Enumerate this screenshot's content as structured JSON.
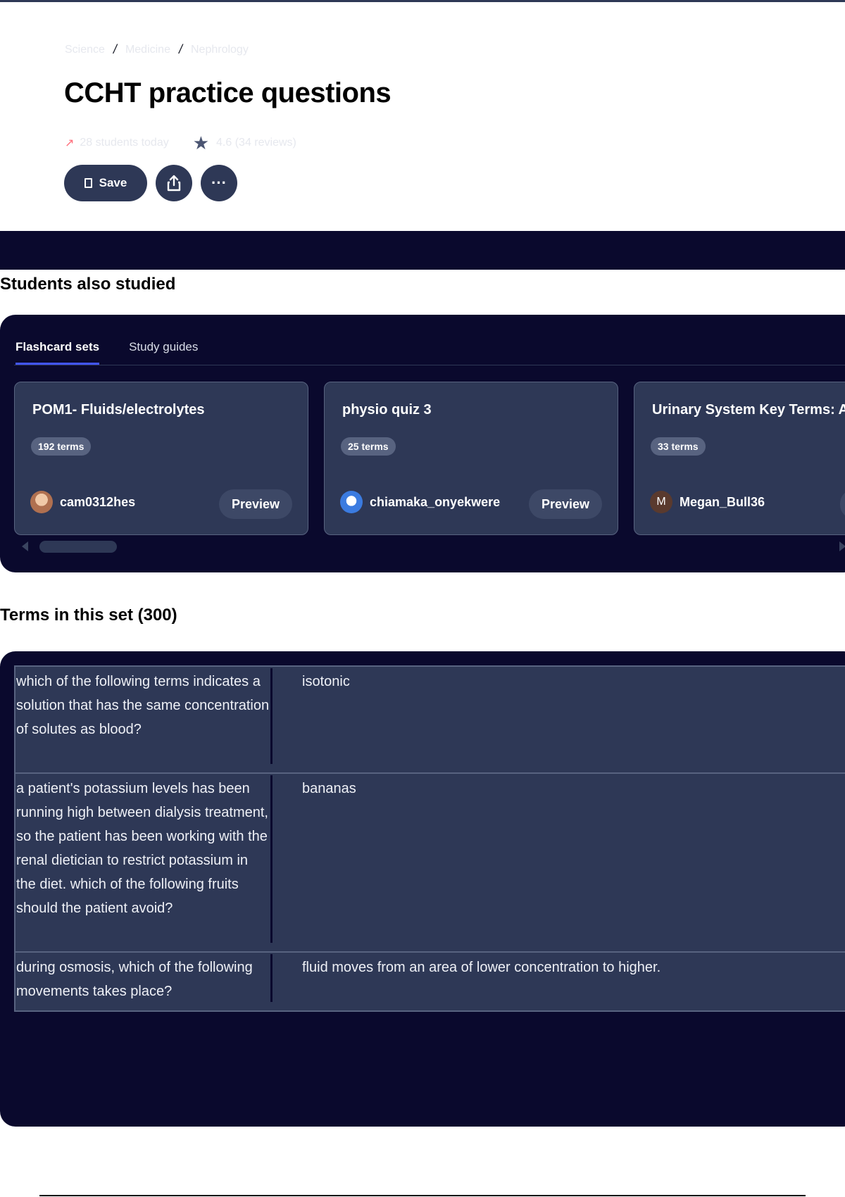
{
  "page": {
    "breadcrumb": [
      "Science",
      "Medicine",
      "Nephrology"
    ],
    "title": "CCHT practice questions",
    "stats": {
      "students_today": "28 students today",
      "rating": "4.6 (34 reviews)"
    },
    "actions": {
      "save_label": "Save",
      "more_label": "···"
    }
  },
  "also_studied": {
    "heading": "Students also studied",
    "tabs": [
      {
        "label": "Flashcard sets",
        "active": true
      },
      {
        "label": "Study guides",
        "active": false
      }
    ],
    "cards": [
      {
        "title": "POM1- Fluids/electrolytes",
        "terms": "192 terms",
        "user": "cam0312hes",
        "avatar_letter": "",
        "avatar_color": "#c98b6b",
        "preview_label": "Preview"
      },
      {
        "title": "physio quiz 3",
        "terms": "25 terms",
        "user": "chiamaka_onyekwere",
        "avatar_letter": "",
        "avatar_color": "#3b7be0",
        "preview_label": "Preview"
      },
      {
        "title": "Urinary System Key Terms: A",
        "terms": "33 terms",
        "user": "Megan_Bull36",
        "avatar_letter": "M",
        "avatar_color": "#5a3a2e",
        "preview_label": ""
      }
    ]
  },
  "terms_section": {
    "heading": "Terms in this set (300)",
    "rows": [
      {
        "question": "which of the following terms indicates a solution that has the same concentration of solutes as blood?",
        "answer": "isotonic"
      },
      {
        "question": "a patient's potassium levels has been running high between dialysis treatment, so the patient has been working with the renal dietician to restrict potassium in the diet. which of the following fruits should the patient avoid?",
        "answer": "bananas"
      },
      {
        "question": "during osmosis, which of the following movements takes place?",
        "answer": "fluid moves from an area of lower concentration to higher."
      }
    ]
  },
  "colors": {
    "dark_navy": "#0a092d",
    "card_bg": "#2e3856",
    "accent_blue": "#4255ff"
  }
}
